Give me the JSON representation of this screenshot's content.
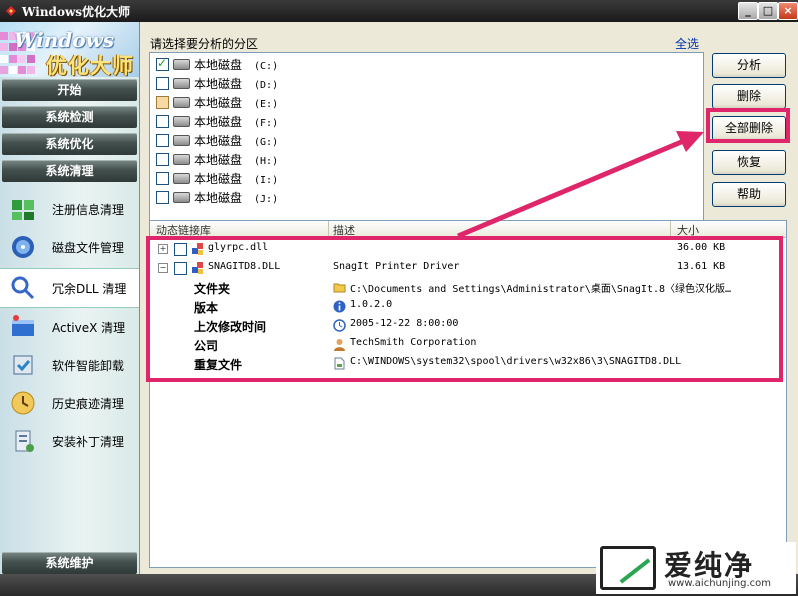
{
  "window": {
    "title": "Windows优化大师"
  },
  "logo": {
    "line1": "Windows",
    "line2": "优化大师"
  },
  "sidebar": {
    "nav": [
      {
        "label": "开始"
      },
      {
        "label": "系统检测"
      },
      {
        "label": "系统优化"
      },
      {
        "label": "系统清理"
      }
    ],
    "tools": [
      {
        "label": "注册信息清理",
        "icon": "registry-clean-icon"
      },
      {
        "label": "磁盘文件管理",
        "icon": "disk-file-icon"
      },
      {
        "label": "冗余DLL 清理",
        "icon": "dll-clean-icon",
        "selected": true
      },
      {
        "label": "ActiveX 清理",
        "icon": "activex-icon"
      },
      {
        "label": "软件智能卸载",
        "icon": "uninstall-icon"
      },
      {
        "label": "历史痕迹清理",
        "icon": "history-icon"
      },
      {
        "label": "安装补丁清理",
        "icon": "patch-icon"
      }
    ],
    "footer": {
      "label": "系统维护"
    }
  },
  "partitions": {
    "header": "请选择要分析的分区",
    "select_all": "全选",
    "items": [
      {
        "label": "本地磁盘",
        "drive": "(C:)",
        "state": "checked"
      },
      {
        "label": "本地磁盘",
        "drive": "(D:)",
        "state": "unchecked"
      },
      {
        "label": "本地磁盘",
        "drive": "(E:)",
        "state": "partial"
      },
      {
        "label": "本地磁盘",
        "drive": "(F:)",
        "state": "unchecked"
      },
      {
        "label": "本地磁盘",
        "drive": "(G:)",
        "state": "unchecked"
      },
      {
        "label": "本地磁盘",
        "drive": "(H:)",
        "state": "unchecked"
      },
      {
        "label": "本地磁盘",
        "drive": "(I:)",
        "state": "unchecked"
      },
      {
        "label": "本地磁盘",
        "drive": "(J:)",
        "state": "unchecked"
      }
    ]
  },
  "buttons": {
    "analyze": "分析",
    "delete": "删除",
    "delete_all": "全部删除",
    "restore": "恢复",
    "help": "帮助"
  },
  "dll_table": {
    "columns": {
      "name": "动态链接库",
      "desc": "描述",
      "size": "大小"
    },
    "rows": [
      {
        "name": "glyrpc.dll",
        "desc": "",
        "size": "36.00 KB",
        "expander": "+"
      },
      {
        "name": "SNAGITD8.DLL",
        "desc": "SnagIt Printer Driver",
        "size": "13.61 KB",
        "expander": "−"
      }
    ],
    "details": [
      {
        "key": "文件夹",
        "value": "C:\\Documents and Settings\\Administrator\\桌面\\SnagIt.8〈绿色汉化版…",
        "icon": "folder-icon"
      },
      {
        "key": "版本",
        "value": "1.0.2.0",
        "icon": "info-icon"
      },
      {
        "key": "上次修改时间",
        "value": "2005-12-22 8:00:00",
        "icon": "clock-icon"
      },
      {
        "key": "公司",
        "value": "TechSmith Corporation",
        "icon": "company-icon"
      },
      {
        "key": "重复文件",
        "value": "C:\\WINDOWS\\system32\\spool\\drivers\\w32x86\\3\\SNAGITD8.DLL",
        "icon": "file-icon"
      }
    ]
  },
  "watermark": {
    "brand": "爱纯净",
    "url": "www.aichunjing.com"
  },
  "colors": {
    "highlight": "#e0266a",
    "nav_bg": "#3a4644",
    "title_bg": "#2a2a2a"
  }
}
